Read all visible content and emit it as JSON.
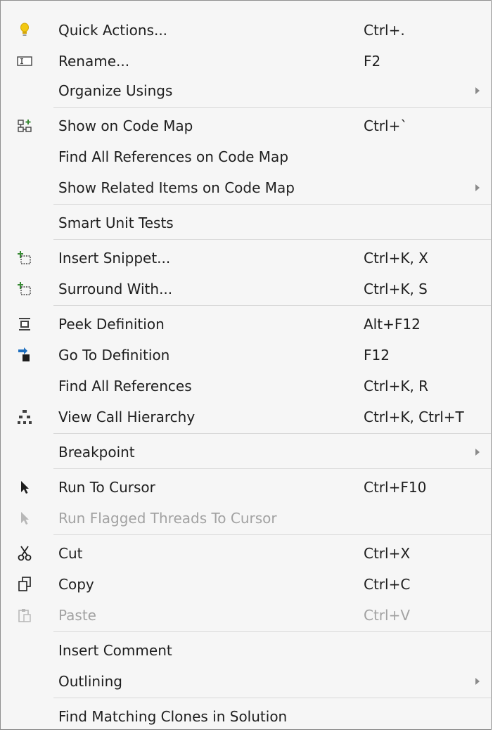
{
  "menu": {
    "items": [
      {
        "label": "Quick Actions...",
        "shortcut": "Ctrl+.",
        "icon": "lightbulb-icon"
      },
      {
        "label": "Rename...",
        "shortcut": "F2",
        "icon": "rename-icon"
      },
      {
        "label": "Organize Usings",
        "shortcut": "",
        "submenu": true
      },
      {
        "label": "Show on Code Map",
        "shortcut": "Ctrl+`",
        "icon": "code-map-icon"
      },
      {
        "label": "Find All References on Code Map",
        "shortcut": ""
      },
      {
        "label": "Show Related Items on Code Map",
        "shortcut": "",
        "submenu": true
      },
      {
        "label": "Smart Unit Tests",
        "shortcut": ""
      },
      {
        "label": "Insert Snippet...",
        "shortcut": "Ctrl+K, X",
        "icon": "insert-snippet-icon"
      },
      {
        "label": "Surround With...",
        "shortcut": "Ctrl+K, S",
        "icon": "surround-with-icon"
      },
      {
        "label": "Peek Definition",
        "shortcut": "Alt+F12",
        "icon": "peek-definition-icon"
      },
      {
        "label": "Go To Definition",
        "shortcut": "F12",
        "icon": "go-to-definition-icon"
      },
      {
        "label": "Find All References",
        "shortcut": "Ctrl+K, R"
      },
      {
        "label": "View Call Hierarchy",
        "shortcut": "Ctrl+K, Ctrl+T",
        "icon": "call-hierarchy-icon"
      },
      {
        "label": "Breakpoint",
        "shortcut": "",
        "submenu": true
      },
      {
        "label": "Run To Cursor",
        "shortcut": "Ctrl+F10",
        "icon": "cursor-arrow-icon"
      },
      {
        "label": "Run Flagged Threads To Cursor",
        "shortcut": "",
        "icon": "cursor-arrow-disabled-icon",
        "disabled": true
      },
      {
        "label": "Cut",
        "shortcut": "Ctrl+X",
        "icon": "scissors-icon"
      },
      {
        "label": "Copy",
        "shortcut": "Ctrl+C",
        "icon": "copy-icon"
      },
      {
        "label": "Paste",
        "shortcut": "Ctrl+V",
        "icon": "paste-icon",
        "disabled": true
      },
      {
        "label": "Insert Comment",
        "shortcut": ""
      },
      {
        "label": "Outlining",
        "shortcut": "",
        "submenu": true
      },
      {
        "label": "Find Matching Clones in Solution",
        "shortcut": ""
      }
    ]
  },
  "colors": {
    "menu_background": "#f6f6f6",
    "border": "#8f8f8f",
    "separator": "#d9d9d9",
    "text": "#1e1e1e",
    "disabled_text": "#a2a2a2",
    "lightbulb": "#f2c811",
    "accent_green": "#388a34",
    "accent_blue": "#1e6fbf"
  }
}
